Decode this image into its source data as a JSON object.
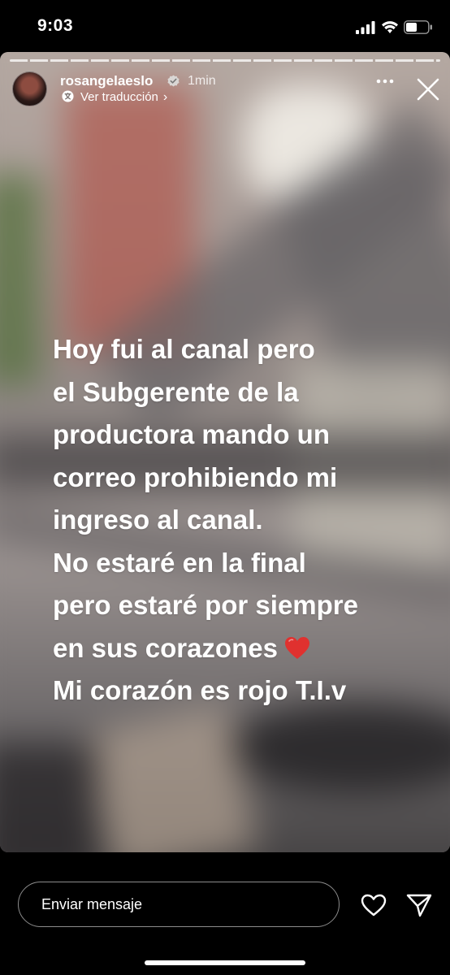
{
  "status_bar": {
    "time": "9:03",
    "signal_icon": "cellular-signal-icon",
    "wifi_icon": "wifi-icon",
    "battery_icon": "battery-icon"
  },
  "story": {
    "progress_segments": 18,
    "user": {
      "username": "rosangelaeslo",
      "verified": true,
      "posted_ago": "1min"
    },
    "translate_link": "Ver traducción",
    "caption_lines": [
      "Hoy fui al canal pero",
      "el Subgerente de la",
      "productora mando un",
      "correo prohibiendo mi",
      "ingreso al canal.",
      "No estaré en la final",
      "pero estaré por siempre",
      "en sus corazones",
      "Mi corazón es rojo T.I.v"
    ],
    "heart_emoji_color": "#e0312f"
  },
  "reply": {
    "placeholder": "Enviar mensaje",
    "like_icon": "heart-icon",
    "send_icon": "send-icon"
  }
}
